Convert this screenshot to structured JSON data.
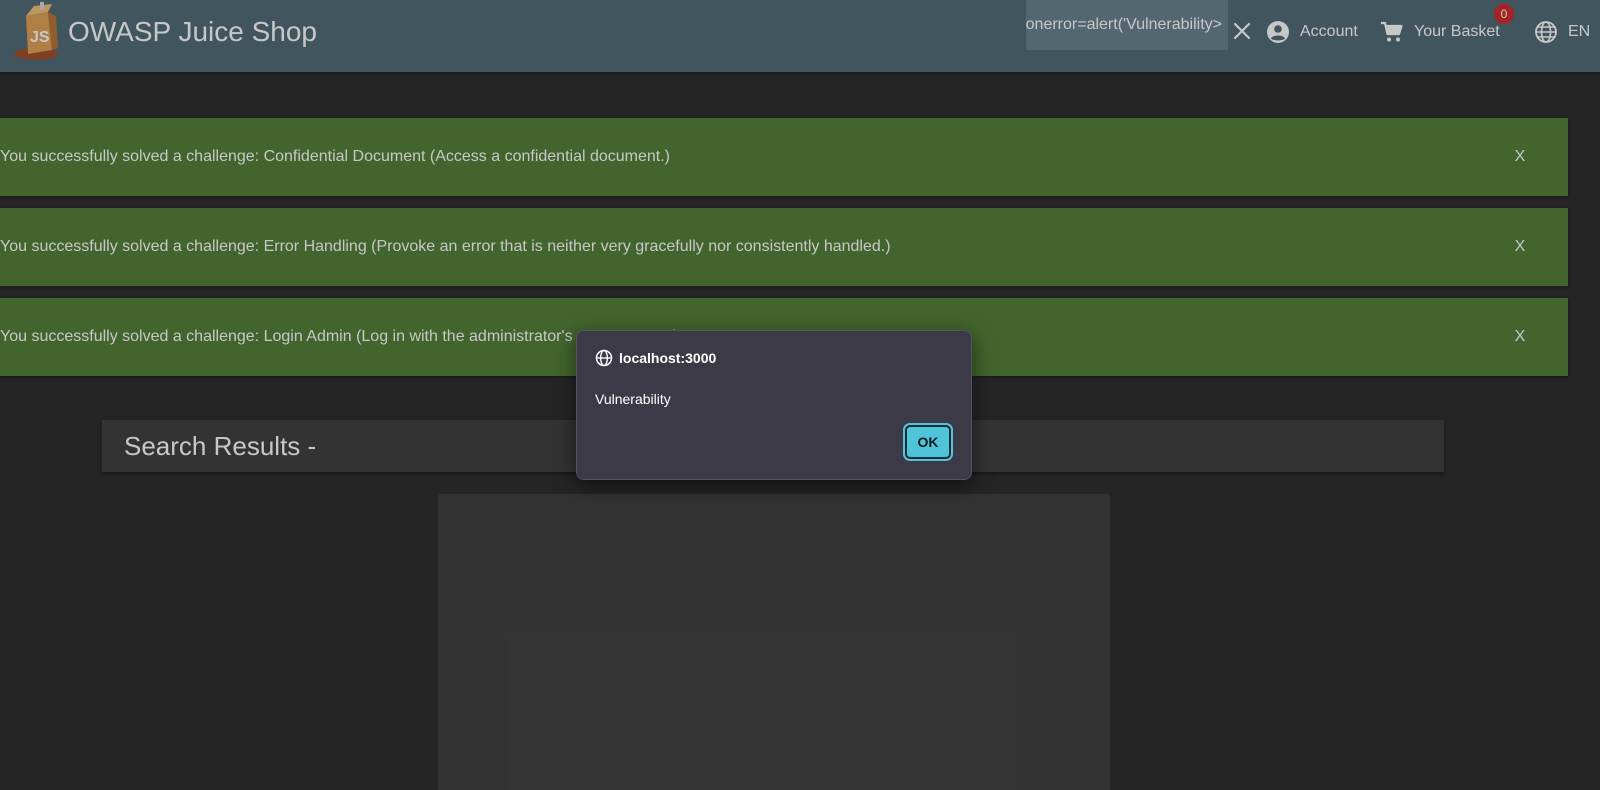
{
  "toolbar": {
    "app_title": "OWASP Juice Shop",
    "search_value": "<img src=x onerror=alert('Vulnerability",
    "account_label": "Account",
    "basket_label": "Your Basket",
    "basket_count": "0",
    "language_label": "EN"
  },
  "notifications": [
    {
      "text": "You successfully solved a challenge: Confidential Document (Access a confidential document.)",
      "close_label": "X"
    },
    {
      "text": "You successfully solved a challenge: Error Handling (Provoke an error that is neither very gracefully nor consistently handled.)",
      "close_label": "X"
    },
    {
      "text": "You successfully solved a challenge: Login Admin (Log in with the administrator's user account.)",
      "close_label": "X"
    }
  ],
  "results": {
    "title": "Search Results -"
  },
  "alert_dialog": {
    "origin": "localhost:3000",
    "message": "Vulnerability",
    "ok_label": "OK"
  },
  "colors": {
    "toolbar": "#546e7a",
    "background": "#303030",
    "notification": "#55803a",
    "ok_button": "#4fc3d9",
    "badge": "#d32f2f"
  }
}
